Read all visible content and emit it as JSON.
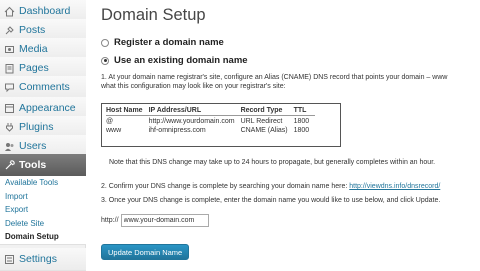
{
  "sidebar": {
    "items": [
      {
        "label": "Dashboard",
        "icon": "dashboard-icon"
      },
      {
        "label": "Posts",
        "icon": "pushpin-icon"
      },
      {
        "label": "Media",
        "icon": "media-icon"
      },
      {
        "label": "Pages",
        "icon": "pages-icon"
      },
      {
        "label": "Comments",
        "icon": "comment-bubble-icon"
      },
      {
        "label": "Appearance",
        "icon": "appearance-icon"
      },
      {
        "label": "Plugins",
        "icon": "plug-icon"
      },
      {
        "label": "Users",
        "icon": "users-icon"
      },
      {
        "label": "Tools",
        "icon": "tools-icon"
      },
      {
        "label": "Settings",
        "icon": "settings-icon"
      }
    ],
    "tools_submenu": [
      "Available Tools",
      "Import",
      "Export",
      "Delete Site",
      "Domain Setup"
    ]
  },
  "page": {
    "title": "Domain Setup",
    "option_register": "Register a domain name",
    "option_existing": "Use an existing domain name",
    "step1_line1": "1. At your domain name registrar's site, configure an Alias (CNAME) DNS record that points your domain – www",
    "step1_line2": "what this configuration may look like on your registrar's site:",
    "table": {
      "headers": [
        "Host Name",
        "IP Address/URL",
        "Record Type",
        "TTL"
      ],
      "rows": [
        [
          "@",
          "http://www.yourdomain.com",
          "URL Redirect",
          "1800"
        ],
        [
          "www",
          "ihf-omnipress.com",
          "CNAME (Alias)",
          "1800"
        ]
      ]
    },
    "note": "Note that this DNS change may take up to 24 hours to propagate, but generally completes within an hour.",
    "step2_text": "2. Confirm your DNS change is complete by searching your domain name here: ",
    "step2_link": "http://viewdns.info/dnsrecord/",
    "step3_text": "3. Once your DNS change is complete, enter the domain name you would like to use below, and click Update.",
    "domain_prefix": "http://",
    "domain_value": "www.your-domain.com",
    "update_button": "Update Domain Name"
  },
  "colors": {
    "link": "#21759b",
    "active_menu": "#6d6d6d",
    "button": "#21759b"
  }
}
